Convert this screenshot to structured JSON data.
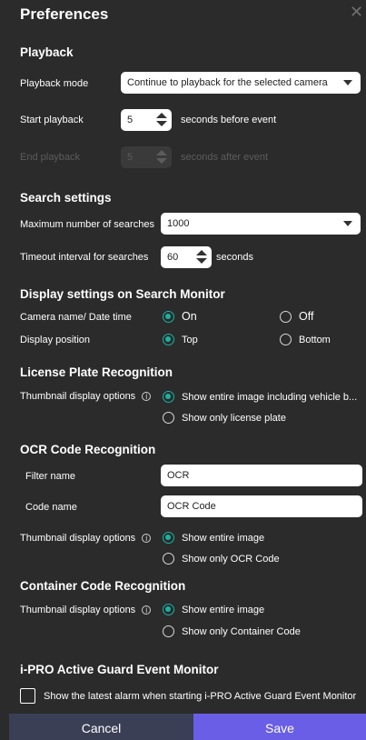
{
  "dialog": {
    "title": "Preferences",
    "close_glyph": "✕"
  },
  "playback": {
    "heading": "Playback",
    "mode_label": "Playback mode",
    "mode_value": "Continue to playback for the selected camera",
    "start_label": "Start playback",
    "start_value": "5",
    "start_suffix": "seconds before event",
    "end_label": "End playback",
    "end_value": "5",
    "end_suffix": "seconds after event"
  },
  "search": {
    "heading": "Search settings",
    "max_label": "Maximum number of searches",
    "max_value": "1000",
    "timeout_label": "Timeout interval for searches",
    "timeout_value": "60",
    "timeout_suffix": "seconds"
  },
  "display": {
    "heading": "Display settings on Search Monitor",
    "camera_label": "Camera name/ Date time",
    "camera_on": "On",
    "camera_off": "Off",
    "camera_selected": "On",
    "position_label": "Display position",
    "position_top": "Top",
    "position_bottom": "Bottom",
    "position_selected": "Top"
  },
  "lpr": {
    "heading": "License Plate Recognition",
    "thumb_label": "Thumbnail display options",
    "opt1": "Show entire image including vehicle b...",
    "opt2": "Show only license plate",
    "selected": "opt1"
  },
  "ocr": {
    "heading": "OCR Code Recognition",
    "filter_label": "Filter name",
    "filter_value": "OCR",
    "code_label": "Code name",
    "code_value": "OCR Code",
    "thumb_label": "Thumbnail display options",
    "opt1": "Show entire image",
    "opt2": "Show only OCR Code",
    "selected": "opt1"
  },
  "container": {
    "heading": "Container Code Recognition",
    "thumb_label": "Thumbnail display options",
    "opt1": "Show entire image",
    "opt2": "Show only Container Code",
    "selected": "opt1"
  },
  "guard": {
    "heading": "i-PRO Active Guard Event Monitor",
    "checkbox_label": "Show the latest alarm when starting i-PRO Active Guard Event Monitor",
    "checked": false
  },
  "footer": {
    "cancel": "Cancel",
    "save": "Save"
  },
  "colors": {
    "background": "#2b2b2b",
    "accent": "#18b3a3",
    "cancel_bg": "#3b3f56",
    "save_bg": "#6a5ee6"
  },
  "icons": {
    "close": "close-icon",
    "info": "info-icon",
    "dropdown": "chevron-down-icon",
    "spinner": "spinner-arrows-icon"
  }
}
